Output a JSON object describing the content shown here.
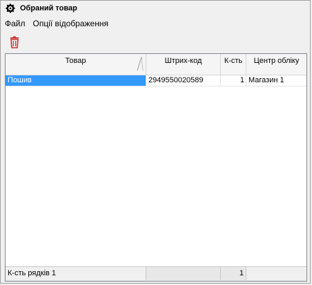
{
  "window": {
    "title": "Обраний товар"
  },
  "menu": {
    "items": [
      "Файл",
      "Опції відображення"
    ]
  },
  "toolbar": {
    "delete_icon": "trash-icon",
    "delete_color": "#d32f2f"
  },
  "grid": {
    "columns": [
      "Товар",
      "Штрих-код",
      "К-сть",
      "Центр обліку"
    ],
    "rows": [
      {
        "product": "Пошив",
        "barcode": "2949550020589",
        "qty": "1",
        "center": "Магазин 1"
      }
    ],
    "selected_color": "#3399ff"
  },
  "footer": {
    "rows_count_label": "К-сть рядків 1",
    "qty_total": "1"
  }
}
